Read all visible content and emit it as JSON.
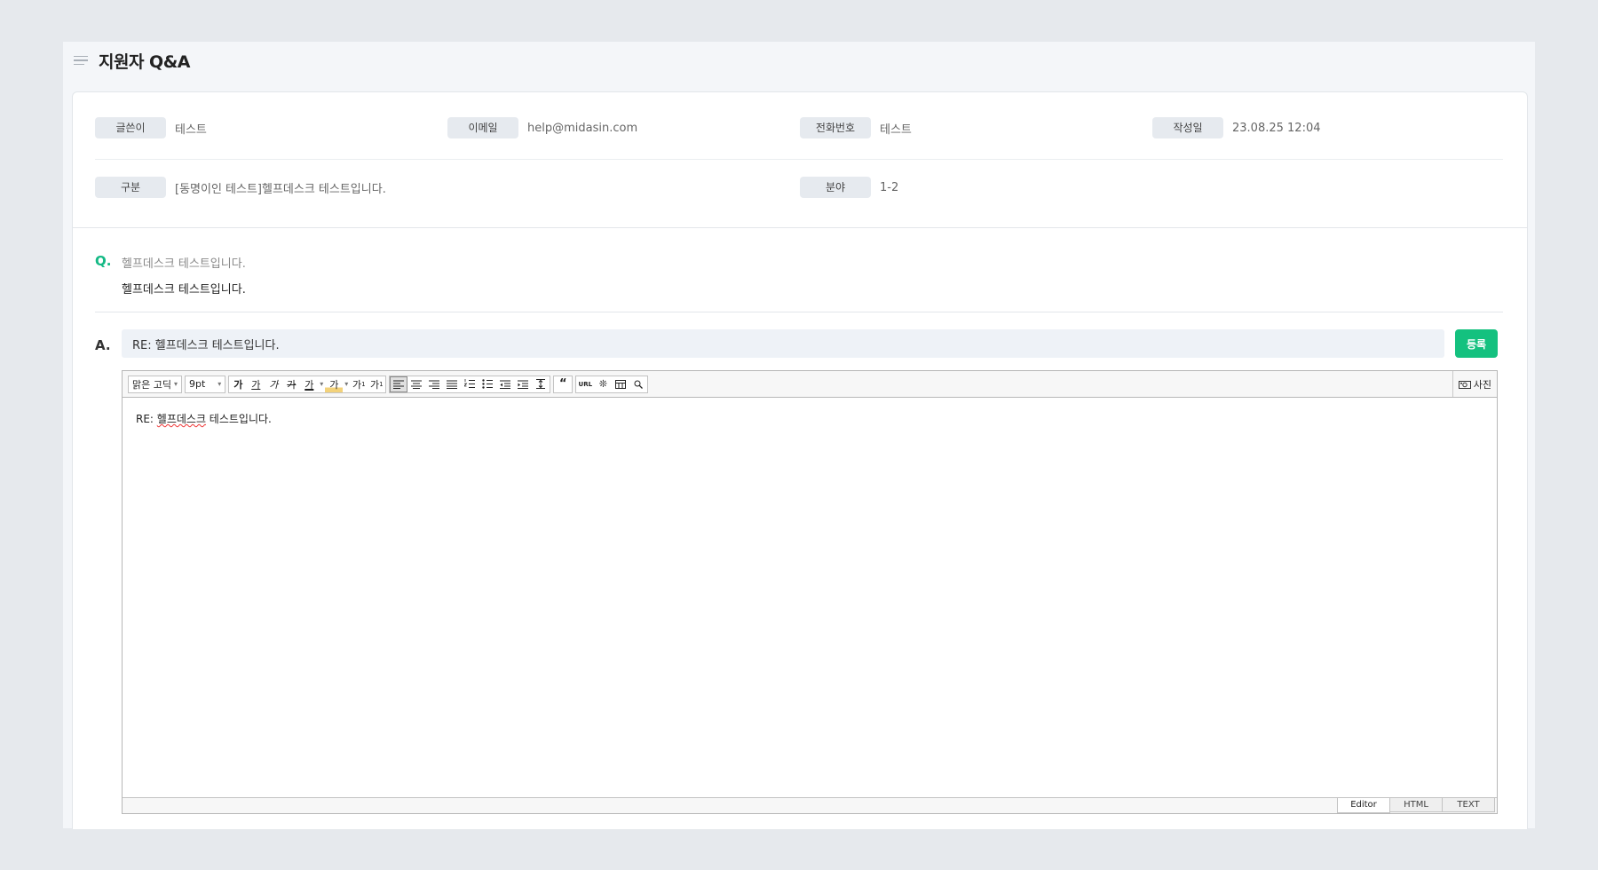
{
  "header": {
    "title": "지원자 Q&A"
  },
  "info": {
    "row1": [
      {
        "label": "글쓴이",
        "value": "테스트"
      },
      {
        "label": "이메일",
        "value": "help@midasin.com"
      },
      {
        "label": "전화번호",
        "value": "테스트"
      },
      {
        "label": "작성일",
        "value": "23.08.25 12:04"
      }
    ],
    "row2": [
      {
        "label": "구분",
        "value": "[동명이인 테스트]헬프데스크 테스트입니다."
      },
      {
        "label": "분야",
        "value": "1-2"
      }
    ]
  },
  "question": {
    "mark": "Q.",
    "title": "헬프데스크 테스트입니다.",
    "body": "헬프데스크 테스트입니다."
  },
  "answer": {
    "mark": "A.",
    "subject_value": "RE: 헬프데스크 테스트입니다.",
    "submit_label": "등록",
    "editor": {
      "font_family": "맑은 고딕",
      "font_size": "9pt",
      "format_buttons": [
        "가",
        "가",
        "가",
        "가",
        "가"
      ],
      "color_buttons": [
        "가",
        "가",
        "가",
        "가"
      ],
      "align_icons": [
        "align-left-icon",
        "align-center-icon",
        "align-right-icon",
        "align-justify-icon",
        "ordered-list-icon",
        "unordered-list-icon",
        "outdent-icon",
        "indent-icon",
        "line-height-icon"
      ],
      "quote_icon": "quote-icon",
      "insert_buttons": [
        "URL",
        "special-char-icon",
        "table-icon",
        "search-icon"
      ],
      "photo_label": "사진",
      "content_prefix": "RE: ",
      "content_misspelled": "헬프데스크",
      "content_suffix": " 테스트입니다.",
      "mode_tabs": [
        "Editor",
        "HTML",
        "TEXT"
      ],
      "active_mode": "Editor"
    }
  },
  "colors": {
    "accent": "#14c17f",
    "q_mark": "#14b985",
    "label_bg": "#e6eaef",
    "page_bg": "#e6e9ed"
  }
}
